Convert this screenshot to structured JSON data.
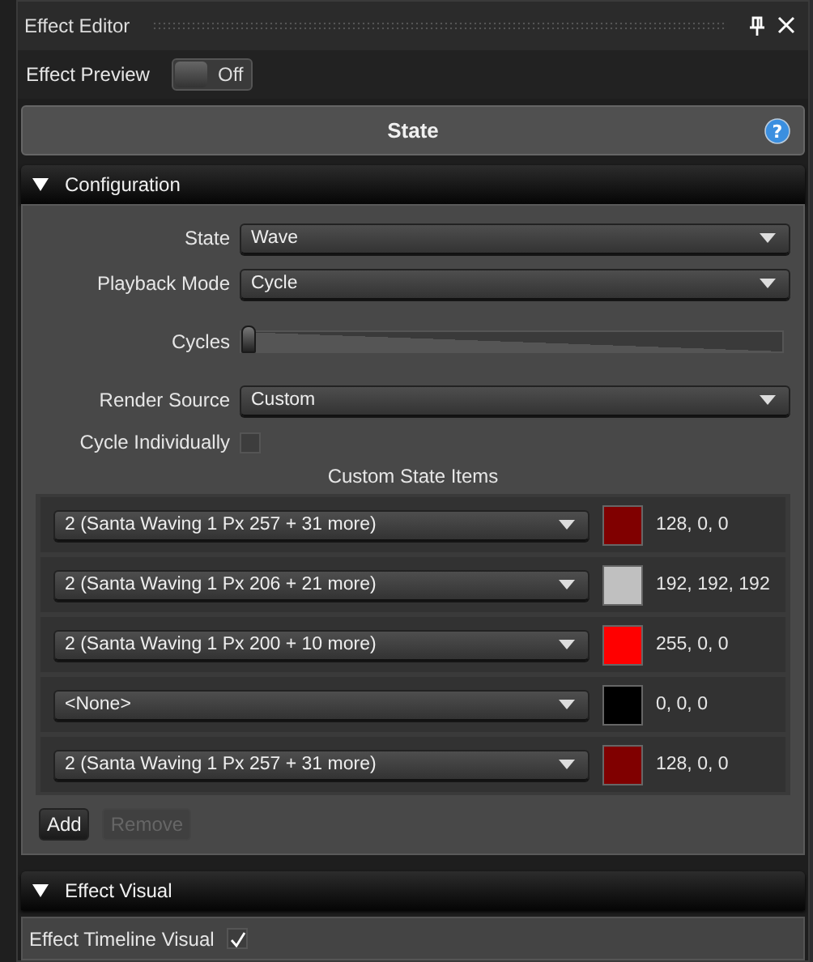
{
  "window": {
    "title": "Effect Editor"
  },
  "preview": {
    "label": "Effect Preview",
    "on": false,
    "state_text": "Off"
  },
  "header": {
    "title": "State",
    "help": "?"
  },
  "configuration": {
    "title": "Configuration",
    "expanded": true,
    "fields": [
      {
        "kind": "dropdown",
        "label": "State",
        "value": "Wave"
      },
      {
        "kind": "dropdown",
        "label": "Playback Mode",
        "value": "Cycle"
      },
      {
        "kind": "slider",
        "label": "Cycles",
        "level": 0
      },
      {
        "kind": "dropdown",
        "label": "Render Source",
        "value": "Custom"
      },
      {
        "kind": "checkbox",
        "label": "Cycle Individually",
        "checked": false
      }
    ],
    "custom_items": {
      "title": "Custom State Items",
      "items": [
        {
          "target": "2 (Santa Waving 1 Px 257 + 31 more)",
          "color": "#800000",
          "rgb": "128, 0, 0"
        },
        {
          "target": "2 (Santa Waving 1 Px 206 + 21 more)",
          "color": "#c0c0c0",
          "rgb": "192, 192, 192"
        },
        {
          "target": "2 (Santa Waving 1 Px 200 + 10 more)",
          "color": "#ff0000",
          "rgb": "255, 0, 0"
        },
        {
          "target": "<None>",
          "color": "#000000",
          "rgb": "0, 0, 0"
        },
        {
          "target": "2 (Santa Waving 1 Px 257 + 31 more)",
          "color": "#800000",
          "rgb": "128, 0, 0"
        }
      ],
      "buttons": [
        {
          "label": "Add",
          "disabled": false
        },
        {
          "label": "Remove",
          "disabled": true
        }
      ]
    }
  },
  "visual": {
    "title": "Effect Visual",
    "expanded": true,
    "timeline": {
      "label": "Effect Timeline Visual",
      "checked": true
    }
  }
}
